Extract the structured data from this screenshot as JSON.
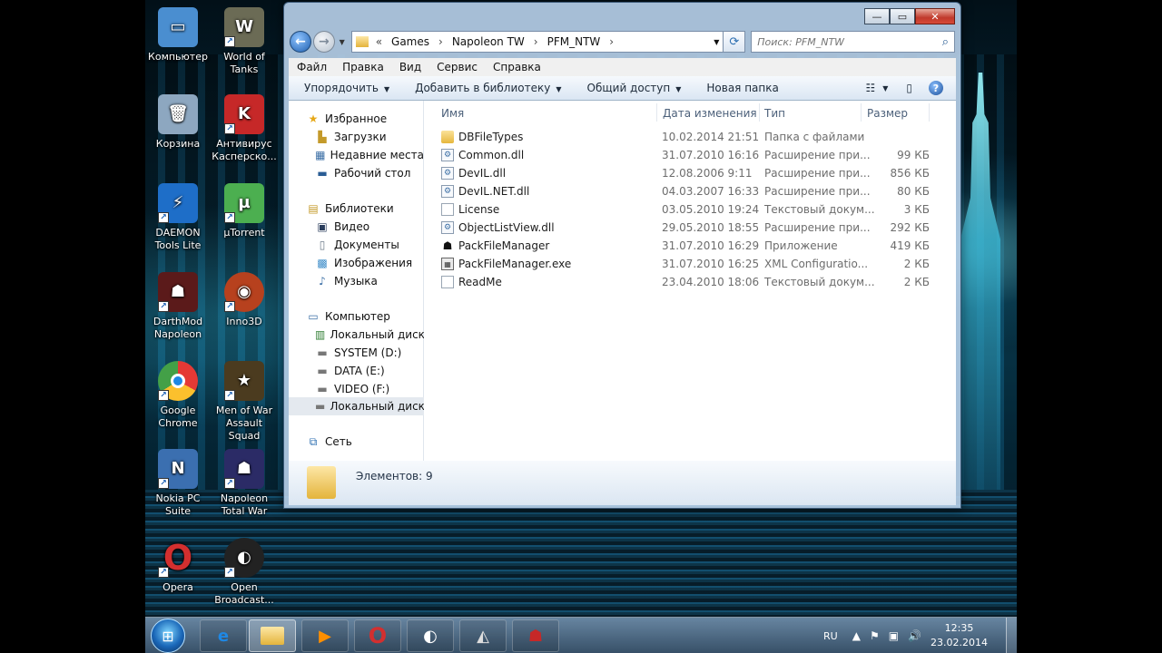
{
  "desktop": {
    "icons": [
      {
        "label": "Компьютер",
        "color": "#4a8ed0",
        "glyph": "▭"
      },
      {
        "label": "World of Tanks",
        "color": "#6b6b55",
        "glyph": "W"
      },
      {
        "label": "Корзина",
        "color": "#8da7c0",
        "glyph": "🗑"
      },
      {
        "label": "Антивирус Касперско...",
        "color": "#c62828",
        "glyph": "K"
      },
      {
        "label": "DAEMON Tools Lite",
        "color": "#1e6ec8",
        "glyph": "⚡"
      },
      {
        "label": "µTorrent",
        "color": "#4caf50",
        "glyph": "µ"
      },
      {
        "label": "DarthMod Napoleon",
        "color": "#5b1a1a",
        "glyph": "☗"
      },
      {
        "label": "Inno3D",
        "color": "#b7411e",
        "glyph": "◉"
      },
      {
        "label": "Google Chrome",
        "color": "#e53935",
        "glyph": "◎"
      },
      {
        "label": "Men of War Assault Squad",
        "color": "#4b3b1f",
        "glyph": "★"
      },
      {
        "label": "Nokia PC Suite",
        "color": "#3b6fb0",
        "glyph": "N"
      },
      {
        "label": "Napoleon Total War",
        "color": "#2b2b66",
        "glyph": "☗"
      },
      {
        "label": "Opera",
        "color": "#d32f2f",
        "glyph": "O"
      },
      {
        "label": "Open Broadcast...",
        "color": "#222222",
        "glyph": "◐"
      }
    ]
  },
  "window": {
    "address": {
      "prefix": "«",
      "crumbs": [
        "Games",
        "Napoleon TW",
        "PFM_NTW"
      ]
    },
    "search_placeholder": "Поиск: PFM_NTW",
    "menu": [
      "Файл",
      "Правка",
      "Вид",
      "Сервис",
      "Справка"
    ],
    "toolbar": {
      "organize": "Упорядочить",
      "add_to_library": "Добавить в библиотеку",
      "share": "Общий доступ",
      "new_folder": "Новая папка"
    },
    "nav": {
      "favorites": "Избранное",
      "downloads": "Загрузки",
      "recent": "Недавние места",
      "desktop": "Рабочий стол",
      "libraries": "Библиотеки",
      "video": "Видео",
      "documents": "Документы",
      "images": "Изображения",
      "music": "Музыка",
      "computer": "Компьютер",
      "drive_c": "Локальный диск (С",
      "drive_d": "SYSTEM (D:)",
      "drive_e": "DATA (E:)",
      "drive_f": "VIDEO (F:)",
      "drive_g": "Локальный диск (G",
      "network": "Сеть"
    },
    "columns": {
      "name": "Имя",
      "date": "Дата изменения",
      "type": "Тип",
      "size": "Размер"
    },
    "files": [
      {
        "name": "DBFileTypes",
        "date": "10.02.2014 21:51",
        "type": "Папка с файлами",
        "size": "",
        "icon": "folder"
      },
      {
        "name": "Common.dll",
        "date": "31.07.2010 16:16",
        "type": "Расширение при...",
        "size": "99 КБ",
        "icon": "dll"
      },
      {
        "name": "DevIL.dll",
        "date": "12.08.2006 9:11",
        "type": "Расширение при...",
        "size": "856 КБ",
        "icon": "dll"
      },
      {
        "name": "DevIL.NET.dll",
        "date": "04.03.2007 16:33",
        "type": "Расширение при...",
        "size": "80 КБ",
        "icon": "dll"
      },
      {
        "name": "License",
        "date": "03.05.2010 19:24",
        "type": "Текстовый докум...",
        "size": "3 КБ",
        "icon": "doc"
      },
      {
        "name": "ObjectListView.dll",
        "date": "29.05.2010 18:55",
        "type": "Расширение при...",
        "size": "292 КБ",
        "icon": "dll"
      },
      {
        "name": "PackFileManager",
        "date": "31.07.2010 16:29",
        "type": "Приложение",
        "size": "419 КБ",
        "icon": "app"
      },
      {
        "name": "PackFileManager.exe",
        "date": "31.07.2010 16:25",
        "type": "XML Configuratio...",
        "size": "2 КБ",
        "icon": "xml"
      },
      {
        "name": "ReadMe",
        "date": "23.04.2010 18:06",
        "type": "Текстовый докум...",
        "size": "2 КБ",
        "icon": "doc"
      }
    ],
    "details": {
      "count": "Элементов: 9"
    }
  },
  "taskbar": {
    "lang": "RU",
    "time": "12:35",
    "date": "23.02.2014"
  },
  "colors": {
    "accent": "#1f5faf",
    "selection": "#e4e9ef"
  }
}
